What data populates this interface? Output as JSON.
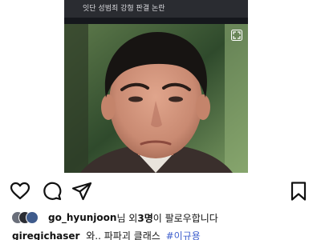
{
  "post": {
    "news_caption": "잇단 성범죄 강형 판결 논란",
    "image_alt": "news photo of a man"
  },
  "actions": {
    "like_icon": "heart-outline-icon",
    "comment_icon": "comment-bubble-icon",
    "share_icon": "paper-plane-icon",
    "save_icon": "bookmark-outline-icon"
  },
  "liked_by": {
    "username": "go_hyunjoon",
    "text_mid": "님 외 ",
    "count": "3명",
    "text_end": "이 팔로우합니다"
  },
  "caption": {
    "username": "giregichaser",
    "text": "와.. 파파괴 클래스",
    "hashtag": "#이규용"
  },
  "colors": {
    "news_bg": "#15171c",
    "caption_bar": "#2a2c31",
    "hashtag": "#3b5ccc"
  }
}
